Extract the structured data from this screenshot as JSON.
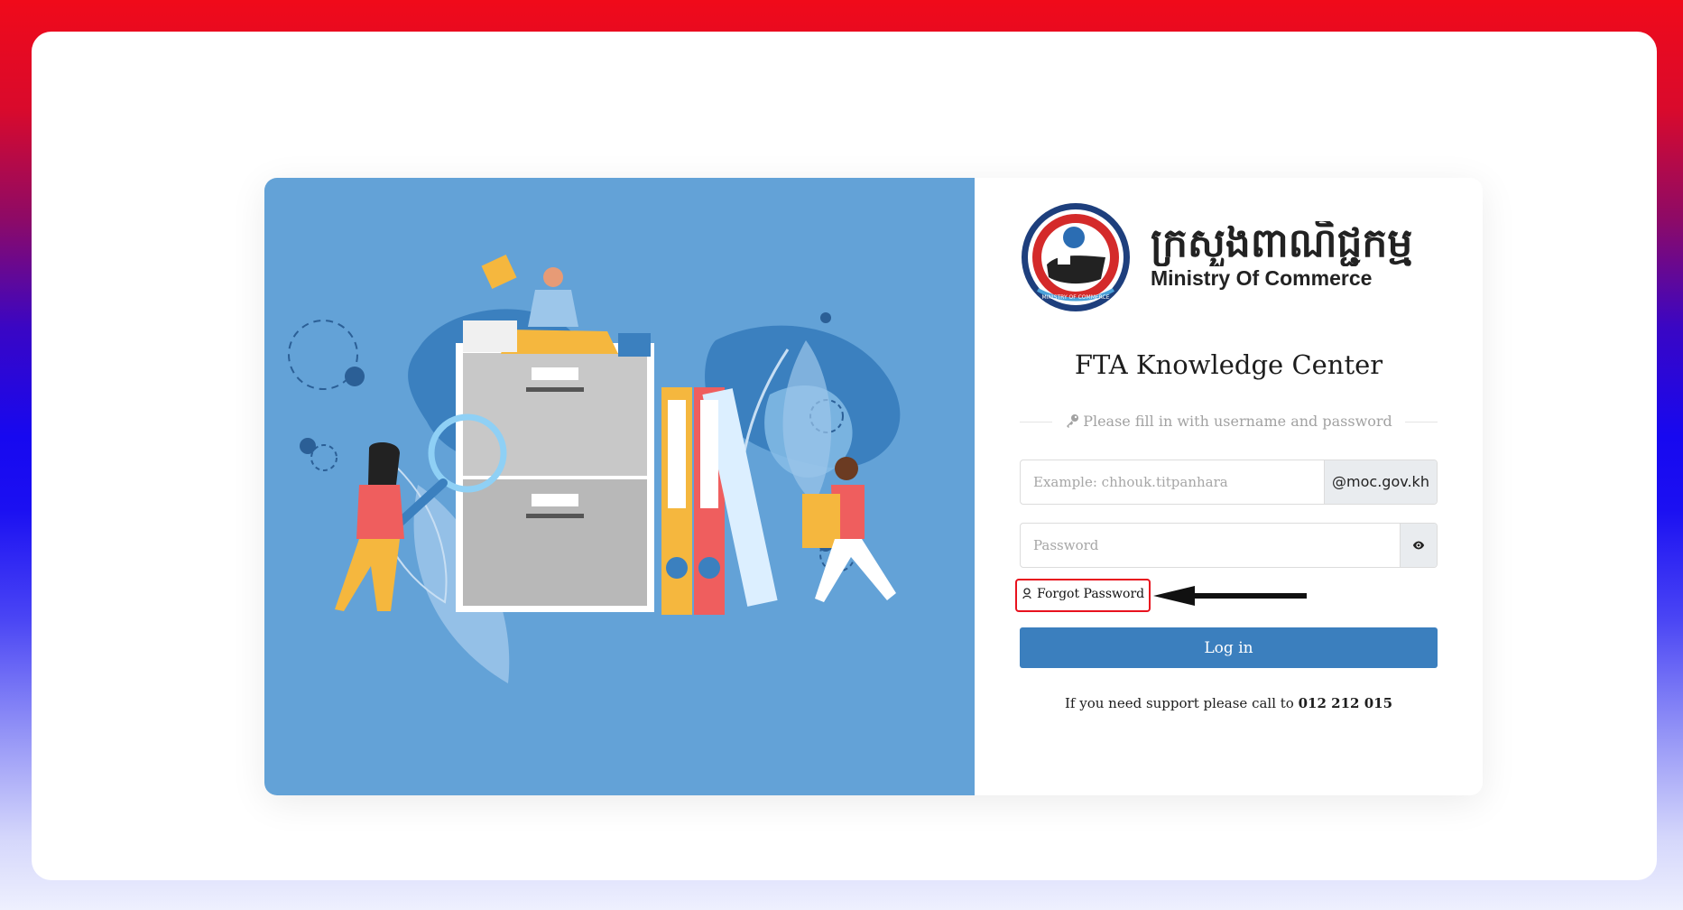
{
  "brand": {
    "name_khmer": "ក្រសួងពាណិជ្ជកម្ម",
    "name_english": "Ministry Of Commerce",
    "logo_ring_text": "MINISTRY OF COMMERCE"
  },
  "login": {
    "title": "FTA Knowledge Center",
    "hint": "Please fill in with username and password",
    "username_placeholder": "Example: chhouk.titpanhara",
    "username_value": "",
    "domain_suffix": "@moc.gov.kh",
    "password_placeholder": "Password",
    "password_value": "",
    "forgot_label": "Forgot Password",
    "submit_label": "Log in",
    "support_prefix": "If you need support please call to",
    "support_phone": "012 212 015"
  },
  "icons": {
    "hint": "key-icon",
    "password_toggle": "eye-icon",
    "forgot": "user-icon",
    "annotation": "arrow-left-icon"
  },
  "colors": {
    "illustration_bg": "#63a2d7",
    "primary_button": "#3b7fbe",
    "highlight_border": "#e8121e",
    "frame_gradient_top": "#f00a1a",
    "frame_gradient_middle": "#1708f0",
    "frame_gradient_bottom": "#eef0fe"
  }
}
